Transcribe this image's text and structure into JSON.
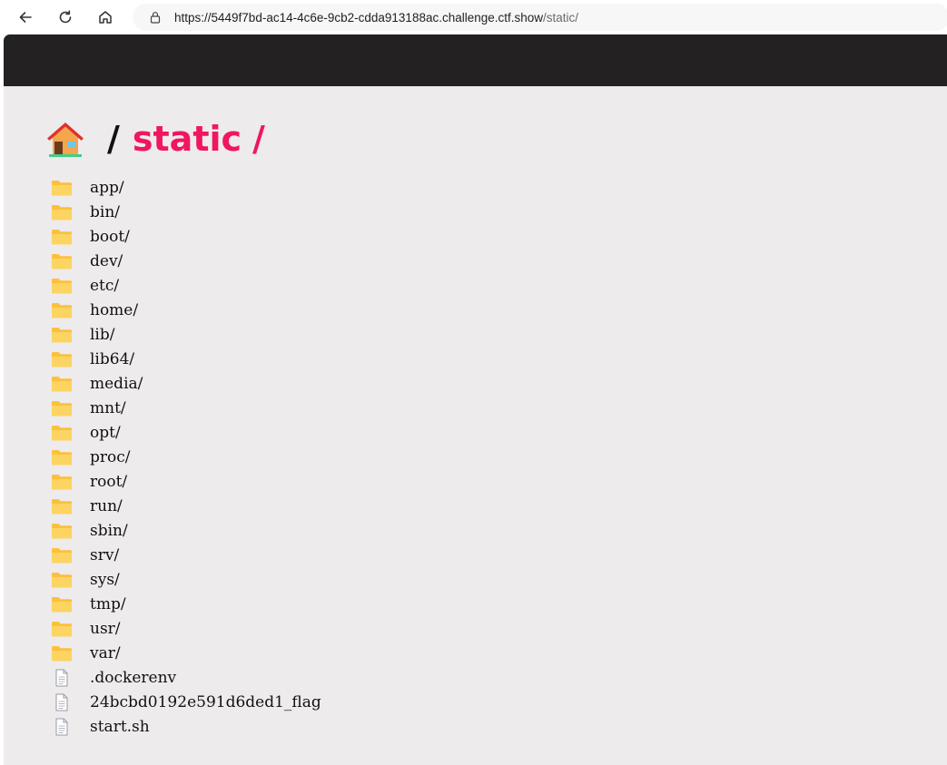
{
  "browser": {
    "url_host": "https://5449f7bd-ac14-4c6e-9cb2-cdda913188ac.challenge.ctf.show",
    "url_path": "/static/",
    "icons": [
      "back-arrow-icon",
      "reload-icon",
      "home-icon",
      "lock-icon"
    ]
  },
  "breadcrumb": {
    "separator": "/",
    "dir": "static",
    "trailing": "/"
  },
  "listing": {
    "folders": [
      "app/",
      "bin/",
      "boot/",
      "dev/",
      "etc/",
      "home/",
      "lib/",
      "lib64/",
      "media/",
      "mnt/",
      "opt/",
      "proc/",
      "root/",
      "run/",
      "sbin/",
      "srv/",
      "sys/",
      "tmp/",
      "usr/",
      "var/"
    ],
    "files": [
      ".dockerenv",
      "24bcbd0192e591d6ded1_flag",
      "start.sh"
    ]
  },
  "colors": {
    "accent": "#f0165f",
    "header": "#232121",
    "background": "#edebec",
    "folder": "#fdc03c"
  }
}
